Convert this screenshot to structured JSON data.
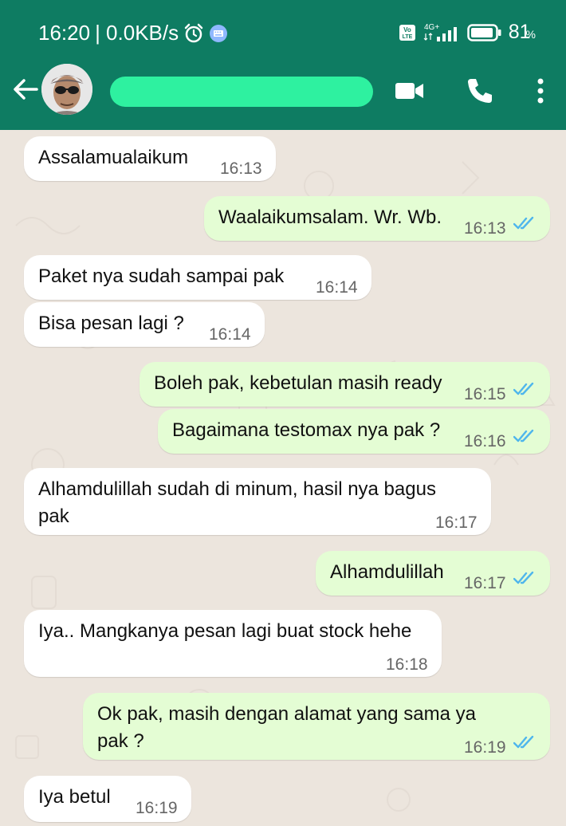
{
  "status_bar": {
    "time": "16:20",
    "net_speed": "| 0.0KB/s",
    "network_label": "4G+",
    "volte_label": "Vo LTE",
    "battery": "81",
    "battery_pct_sign": "%"
  },
  "header": {
    "contact_name": "",
    "colors": {
      "header_bg": "#0e7c62",
      "redaction": "#2ef1a0"
    }
  },
  "messages": [
    {
      "dir": "in",
      "text": "Assalamualaikum",
      "time": "16:13"
    },
    {
      "dir": "out",
      "text": "Waalaikumsalam. Wr. Wb.",
      "time": "16:13"
    },
    {
      "dir": "in",
      "text": "Paket nya sudah sampai pak",
      "time": "16:14"
    },
    {
      "dir": "in",
      "text": "Bisa pesan lagi ?",
      "time": "16:14"
    },
    {
      "dir": "out",
      "text": "Boleh pak, kebetulan masih ready",
      "time": "16:15"
    },
    {
      "dir": "out",
      "text": "Bagaimana testomax nya pak ?",
      "time": "16:16"
    },
    {
      "dir": "in",
      "text": "Alhamdulillah sudah di minum, hasil nya bagus pak",
      "time": "16:17"
    },
    {
      "dir": "out",
      "text": "Alhamdulillah",
      "time": "16:17"
    },
    {
      "dir": "in",
      "text": "Iya.. Mangkanya pesan lagi buat stock hehe",
      "time": "16:18"
    },
    {
      "dir": "out",
      "text": "Ok pak, masih dengan alamat yang sama ya pak ?",
      "time": "16:19"
    },
    {
      "dir": "in",
      "text": "Iya betul",
      "time": "16:19"
    }
  ],
  "colors": {
    "chat_bg": "#ece5dd",
    "incoming_bubble": "#ffffff",
    "outgoing_bubble": "#e4fdd4",
    "read_tick": "#4fb6ec"
  }
}
